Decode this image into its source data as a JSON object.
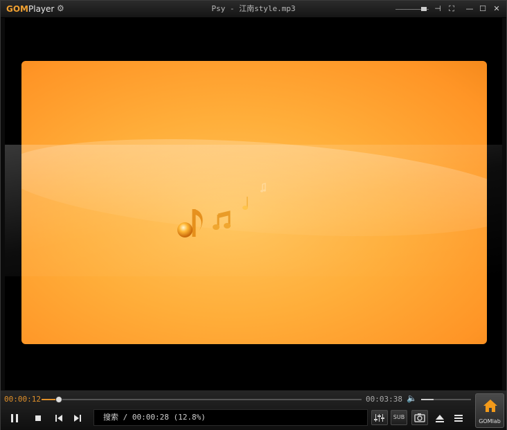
{
  "app": {
    "brand_gom": "GOM",
    "brand_player": "Player"
  },
  "window": {
    "title": "Psy - 江南style.mp3"
  },
  "titlebar": {
    "icons": [
      "pin-icon",
      "pip-icon",
      "minimize-icon",
      "maximize-icon",
      "close-icon"
    ]
  },
  "playback": {
    "current_time": "00:00:12",
    "total_time": "00:03:38",
    "progress": 0.055,
    "volume": 0.25,
    "state": "playing"
  },
  "status": {
    "text": "搜索 / 00:00:28 (12.8%)"
  },
  "buttons": {
    "sub_label": "SUB",
    "gomlab_label": "GOMlab"
  },
  "colors": {
    "accent": "#e0902a",
    "artwork": "#ffa53a"
  }
}
